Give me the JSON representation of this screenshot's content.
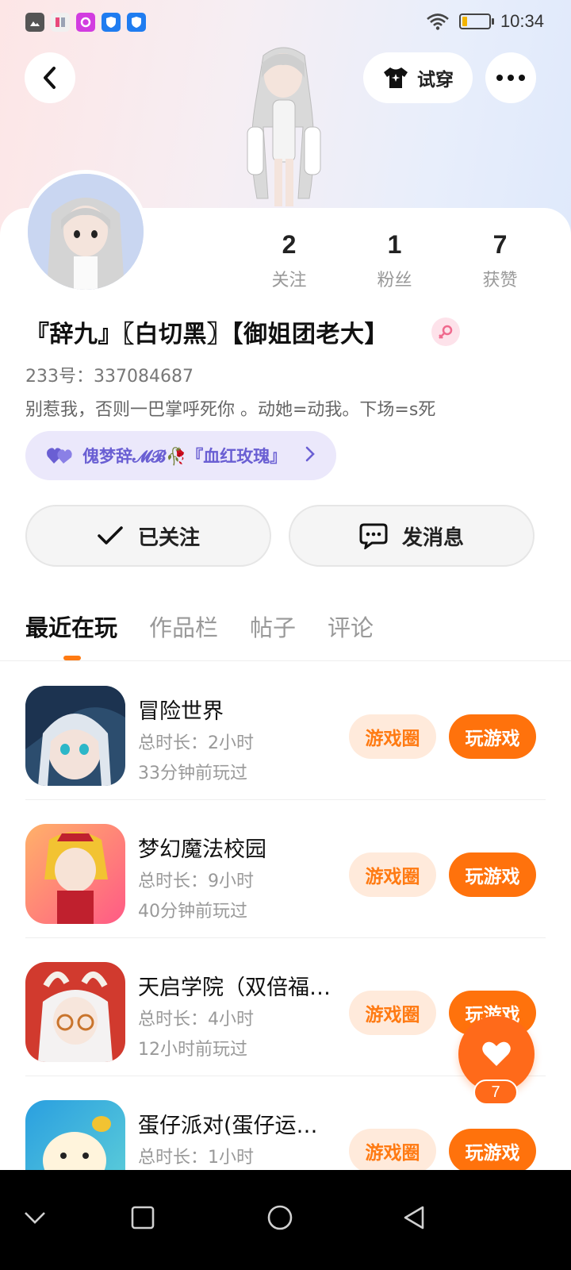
{
  "status_bar": {
    "time": "10:34",
    "battery_level": 0.2,
    "left_icons": [
      "gallery-icon",
      "app-icon",
      "app-icon-purple",
      "shield-app-icon",
      "shield-app-icon"
    ]
  },
  "header": {
    "try_on_label": "试穿"
  },
  "profile": {
    "stats": [
      {
        "value": "2",
        "label": "关注"
      },
      {
        "value": "1",
        "label": "粉丝"
      },
      {
        "value": "7",
        "label": "获赞"
      }
    ],
    "nickname": "『辞九』〖白切黑〗【御姐团老大】",
    "uid": "233号：337084687",
    "bio": "别惹我，否则一巴掌呼死你 。动她=动我。下场=s死",
    "couple_label": "傀梦辞𝓜𝓑🥀『血红玫瑰』",
    "follow_label": "已关注",
    "message_label": "发消息"
  },
  "tabs": [
    {
      "label": "最近在玩",
      "active": true
    },
    {
      "label": "作品栏",
      "active": false
    },
    {
      "label": "帖子",
      "active": false
    },
    {
      "label": "评论",
      "active": false
    }
  ],
  "games": [
    {
      "name": "冒险世界",
      "duration": "总时长：2小时",
      "last_played": "33分钟前玩过",
      "circle_label": "游戏圈",
      "play_label": "玩游戏"
    },
    {
      "name": "梦幻魔法校园",
      "duration": "总时长：9小时",
      "last_played": "40分钟前玩过",
      "circle_label": "游戏圈",
      "play_label": "玩游戏"
    },
    {
      "name": "天启学院（双倍福利）",
      "duration": "总时长：4小时",
      "last_played": "12小时前玩过",
      "circle_label": "游戏圈",
      "play_label": "玩游戏"
    },
    {
      "name": "蛋仔派对(蛋仔运动会)",
      "duration": "总时长：1小时",
      "last_played": "",
      "circle_label": "游戏圈",
      "play_label": "玩游戏"
    }
  ],
  "like_fab": {
    "count": "7"
  },
  "colors": {
    "accent": "#ff720c",
    "accent_light": "#ffeadb",
    "couple_bg": "#ebe8fb",
    "couple_text": "#6a5fd3"
  }
}
